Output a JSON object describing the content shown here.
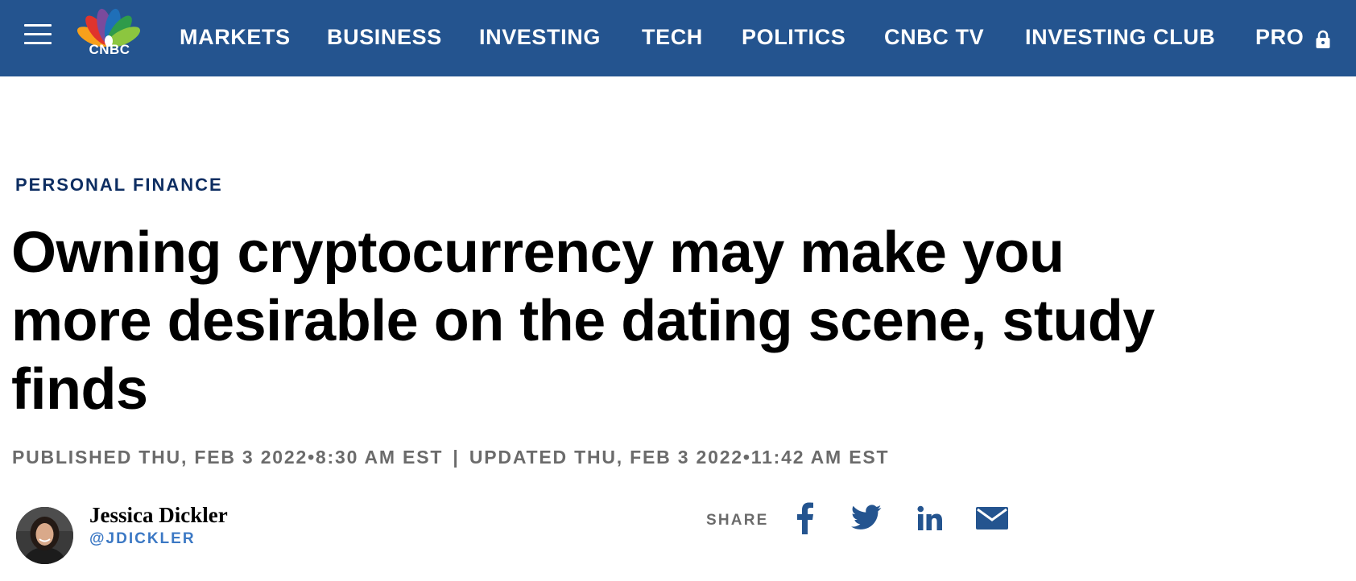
{
  "nav": {
    "logo_text": "CNBC",
    "items": [
      {
        "label": "MARKETS"
      },
      {
        "label": "BUSINESS"
      },
      {
        "label": "INVESTING"
      },
      {
        "label": "TECH"
      },
      {
        "label": "POLITICS"
      },
      {
        "label": "CNBC TV"
      },
      {
        "label": "INVESTING CLUB"
      },
      {
        "label": "PRO"
      }
    ],
    "background_color": "#24548f"
  },
  "article": {
    "category": "PERSONAL FINANCE",
    "headline": "Owning cryptocurrency may make you more desirable on the dating scene, study finds",
    "published_label": "PUBLISHED THU, FEB 3 2022•8:30 AM EST",
    "separator": "|",
    "updated_label": "UPDATED THU, FEB 3 2022•11:42 AM EST"
  },
  "author": {
    "name": "Jessica Dickler",
    "handle": "@JDICKLER"
  },
  "share": {
    "label": "SHARE",
    "icons": [
      "facebook-icon",
      "twitter-icon",
      "linkedin-icon",
      "email-icon"
    ],
    "icon_color": "#24548f"
  }
}
